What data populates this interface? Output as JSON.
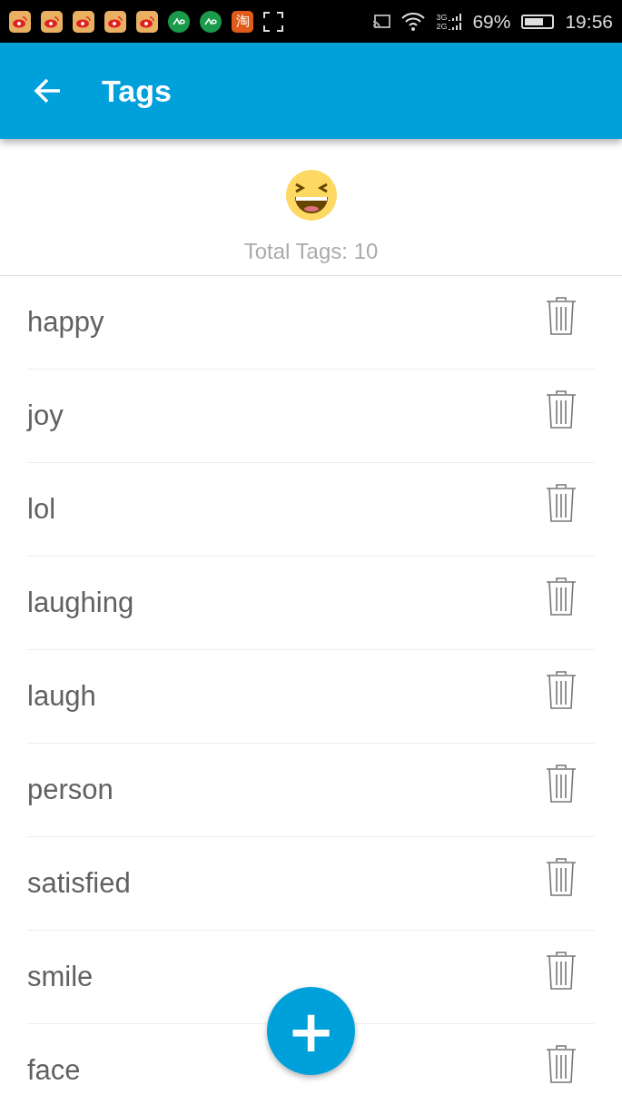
{
  "status_bar": {
    "app_icons": [
      {
        "kind": "weibo"
      },
      {
        "kind": "weibo"
      },
      {
        "kind": "weibo"
      },
      {
        "kind": "weibo"
      },
      {
        "kind": "weibo"
      },
      {
        "kind": "green"
      },
      {
        "kind": "green"
      },
      {
        "kind": "taobao",
        "label": "淘"
      },
      {
        "kind": "screenshot"
      }
    ],
    "network_top": "3G",
    "network_bottom": "2G",
    "battery_percent": "69%",
    "time": "19:56"
  },
  "app_bar": {
    "title": "Tags"
  },
  "summary": {
    "total": "Total Tags: 10"
  },
  "tags": [
    {
      "label": "happy"
    },
    {
      "label": "joy"
    },
    {
      "label": "lol"
    },
    {
      "label": "laughing"
    },
    {
      "label": "laugh"
    },
    {
      "label": "person"
    },
    {
      "label": "satisfied"
    },
    {
      "label": "smile"
    },
    {
      "label": "face"
    }
  ],
  "fab": {
    "label": "+"
  }
}
